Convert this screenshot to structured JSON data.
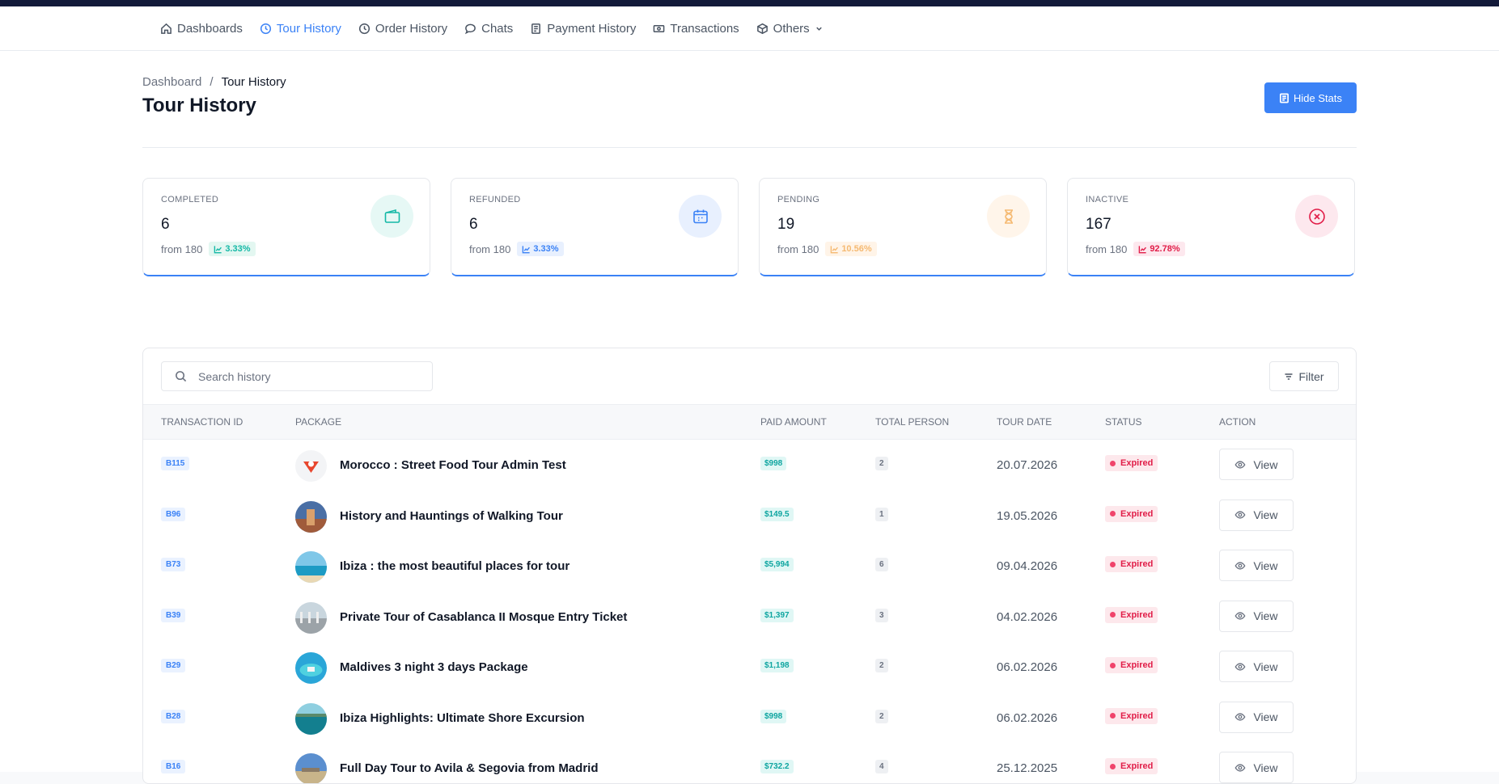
{
  "nav": {
    "items": [
      {
        "label": "Dashboards",
        "icon": "home-icon",
        "active": false
      },
      {
        "label": "Tour History",
        "icon": "history-icon",
        "active": true
      },
      {
        "label": "Order History",
        "icon": "history-icon",
        "active": false
      },
      {
        "label": "Chats",
        "icon": "chat-icon",
        "active": false
      },
      {
        "label": "Payment History",
        "icon": "receipt-icon",
        "active": false
      },
      {
        "label": "Transactions",
        "icon": "money-icon",
        "active": false
      },
      {
        "label": "Others",
        "icon": "box-icon",
        "active": false
      }
    ]
  },
  "breadcrumb": {
    "root": "Dashboard",
    "sep": "/",
    "current": "Tour History"
  },
  "page": {
    "title": "Tour History",
    "hide_stats": "Hide Stats"
  },
  "stats": [
    {
      "label": "COMPLETED",
      "value": "6",
      "from": "from 180",
      "pct": "3.33%",
      "icon": "wallet-icon",
      "color": "#14b8a6",
      "bg": "#e6f8f5",
      "pct_bg": "#e3f7f1"
    },
    {
      "label": "REFUNDED",
      "value": "6",
      "from": "from 180",
      "pct": "3.33%",
      "icon": "calendar-icon",
      "color": "#3b82f6",
      "bg": "#e8f0fe",
      "pct_bg": "#e8f0fe"
    },
    {
      "label": "PENDING",
      "value": "19",
      "from": "from 180",
      "pct": "10.56%",
      "icon": "hourglass-icon",
      "color": "#f5b971",
      "bg": "#fff5ea",
      "pct_bg": "#fff4e8"
    },
    {
      "label": "INACTIVE",
      "value": "167",
      "from": "from 180",
      "pct": "92.78%",
      "icon": "close-circle-icon",
      "color": "#e11d48",
      "bg": "#fde8ee",
      "pct_bg": "#fde8ee"
    }
  ],
  "search": {
    "placeholder": "Search history"
  },
  "filter": {
    "label": "Filter"
  },
  "table": {
    "headers": [
      "TRANSACTION ID",
      "PACKAGE",
      "PAID AMOUNT",
      "TOTAL PERSON",
      "TOUR DATE",
      "STATUS",
      "ACTION"
    ],
    "rows": [
      {
        "id": "B115",
        "package": "Morocco : Street Food Tour Admin Test",
        "amount": "$998",
        "persons": "2",
        "date": "20.07.2026",
        "status": "Expired",
        "action": "View",
        "thumb": "logo"
      },
      {
        "id": "B96",
        "package": "History and Hauntings of Walking Tour",
        "amount": "$149.5",
        "persons": "1",
        "date": "19.05.2026",
        "status": "Expired",
        "action": "View",
        "thumb": "city"
      },
      {
        "id": "B73",
        "package": "Ibiza : the most beautiful places for tour",
        "amount": "$5,994",
        "persons": "6",
        "date": "09.04.2026",
        "status": "Expired",
        "action": "View",
        "thumb": "beach"
      },
      {
        "id": "B39",
        "package": "Private Tour of Casablanca II Mosque Entry Ticket",
        "amount": "$1,397",
        "persons": "3",
        "date": "04.02.2026",
        "status": "Expired",
        "action": "View",
        "thumb": "mosque"
      },
      {
        "id": "B29",
        "package": "Maldives 3 night 3 days Package",
        "amount": "$1,198",
        "persons": "2",
        "date": "06.02.2026",
        "status": "Expired",
        "action": "View",
        "thumb": "maldives"
      },
      {
        "id": "B28",
        "package": "Ibiza Highlights: Ultimate Shore Excursion",
        "amount": "$998",
        "persons": "2",
        "date": "06.02.2026",
        "status": "Expired",
        "action": "View",
        "thumb": "sea"
      },
      {
        "id": "B16",
        "package": "Full Day Tour to Avila & Segovia from Madrid",
        "amount": "$732.2",
        "persons": "4",
        "date": "25.12.2025",
        "status": "Expired",
        "action": "View",
        "thumb": "field"
      }
    ]
  }
}
